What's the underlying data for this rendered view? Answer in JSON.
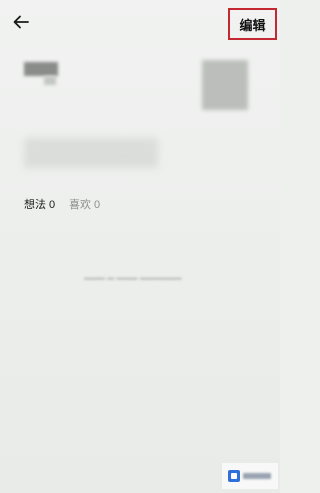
{
  "header": {
    "back_icon": "arrow-left-icon",
    "edit_label": "编辑",
    "edit_highlight_color": "#c42830"
  },
  "tabs": {
    "thoughts": "想法 0",
    "likes": "喜欢 0"
  },
  "watermark": {
    "logo_icon": "site-logo-icon",
    "logo_color": "#2f6fd8"
  }
}
